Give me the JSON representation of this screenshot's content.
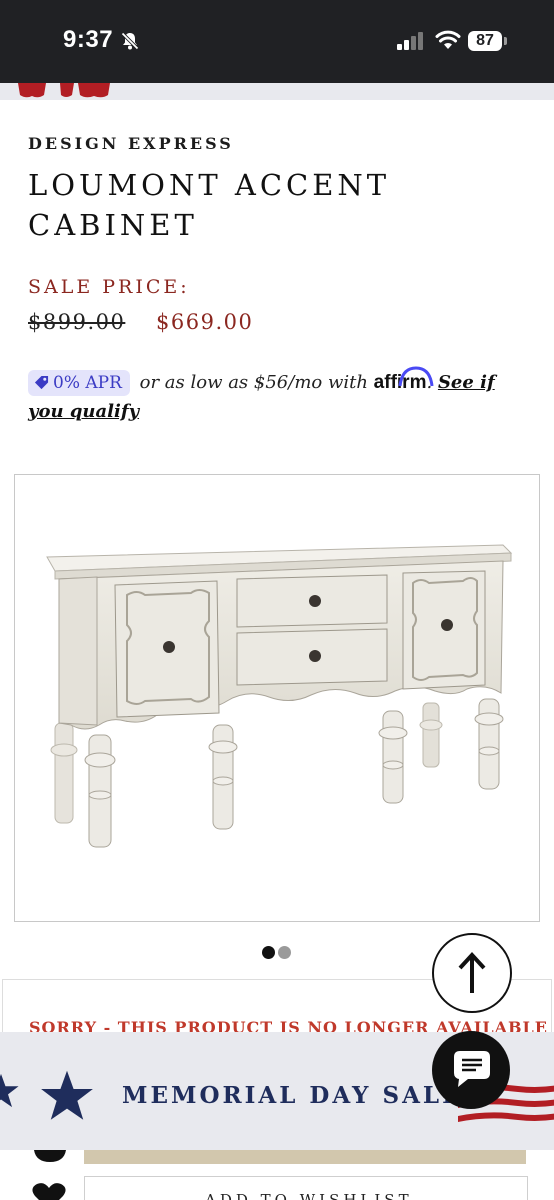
{
  "status_bar": {
    "time": "9:37",
    "battery": "87"
  },
  "product": {
    "brand": "DESIGN EXPRESS",
    "title": "LOUMONT ACCENT CABINET",
    "sale_label": "SALE PRICE:",
    "original_price": "$899.00",
    "sale_price": "$669.00"
  },
  "affirm": {
    "apr_badge": "0% APR",
    "text_before": "or as low as $56/mo with",
    "logo": "affirm",
    "period": ".",
    "link": "See if you qualify"
  },
  "carousel": {
    "slides": 2,
    "active_index": 0
  },
  "notice": {
    "text": "SORRY - THIS PRODUCT IS NO LONGER AVAILABLE"
  },
  "promo": {
    "text": "MEMORIAL DAY SALE"
  },
  "actions": {
    "wishlist_label": "ADD TO WISHLIST"
  },
  "icons": [
    "bell-slash-icon",
    "signal-icon",
    "wifi-icon",
    "tag-icon",
    "arrow-up-icon",
    "chat-icon",
    "star-icon",
    "heart-icon"
  ],
  "colors": {
    "accent_red": "#8b2720",
    "navy": "#1f2d5c",
    "affirm_blue": "#3b3bc4",
    "cart_bar": "#d2c7ad"
  }
}
